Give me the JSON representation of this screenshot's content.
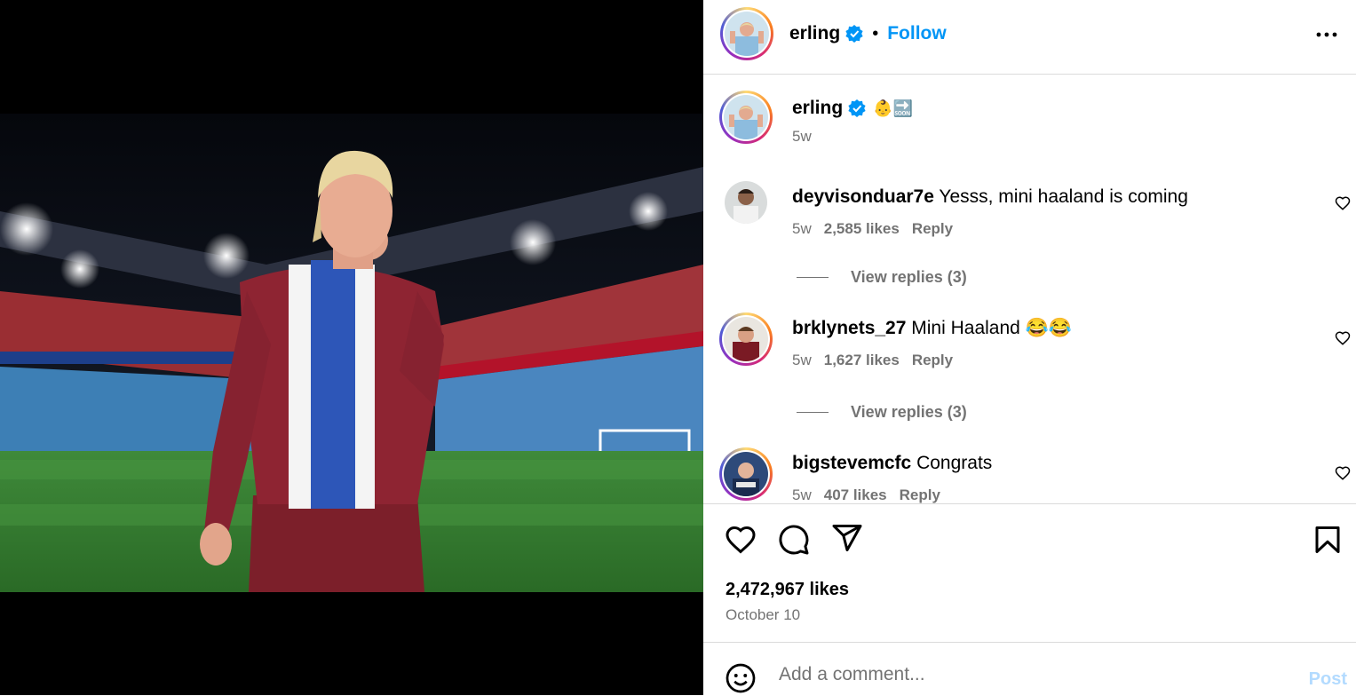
{
  "post": {
    "author": "erling",
    "follow_label": "Follow",
    "separator": "•",
    "more_icon": "more-horizontal-icon"
  },
  "caption": {
    "author": "erling",
    "emojis": "👶🔜",
    "time": "5w"
  },
  "comments": [
    {
      "author": "deyvisonduar7e",
      "text": "Yesss, mini haaland is coming",
      "time": "5w",
      "likes": "2,585 likes",
      "reply_label": "Reply",
      "view_replies": "View replies (3)"
    },
    {
      "author": "brklynets_27",
      "text": "Mini Haaland 😂😂",
      "time": "5w",
      "likes": "1,627 likes",
      "reply_label": "Reply",
      "view_replies": "View replies (3)"
    },
    {
      "author": "bigstevemcfc",
      "text": "Congrats",
      "time": "5w",
      "likes": "407 likes",
      "reply_label": "Reply"
    }
  ],
  "stats": {
    "likes": "2,472,967 likes",
    "date": "October 10"
  },
  "comment_box": {
    "placeholder": "Add a comment...",
    "post_label": "Post"
  },
  "colors": {
    "accent": "#0095f6",
    "muted": "#737373",
    "border": "#dbdbdb",
    "verified": "#0095f6"
  }
}
